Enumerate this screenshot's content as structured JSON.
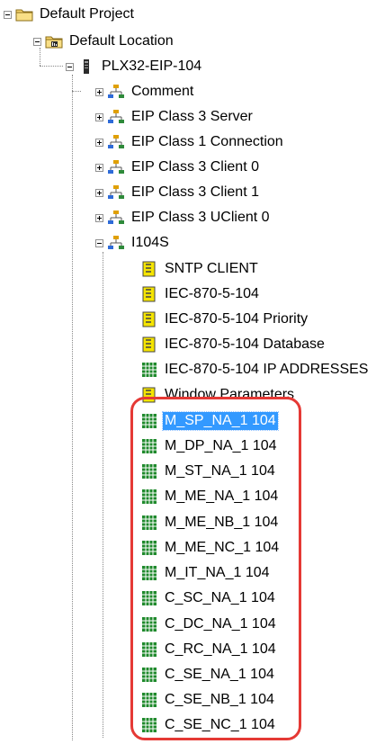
{
  "tree": {
    "root": {
      "label": "Default Project",
      "expanded": true,
      "icon": "folder-icon"
    },
    "location": {
      "label": "Default Location",
      "expanded": true,
      "icon": "location-folder-icon"
    },
    "module": {
      "label": "PLX32-EIP-104",
      "expanded": true,
      "icon": "device-icon"
    },
    "nodes": [
      {
        "label": "Comment",
        "expanded": false,
        "icon": "network-icon"
      },
      {
        "label": "EIP Class 3 Server",
        "expanded": false,
        "icon": "network-icon"
      },
      {
        "label": "EIP Class 1 Connection",
        "expanded": false,
        "icon": "network-icon"
      },
      {
        "label": "EIP Class 3 Client 0",
        "expanded": false,
        "icon": "network-icon"
      },
      {
        "label": "EIP Class 3 Client 1",
        "expanded": false,
        "icon": "network-icon"
      },
      {
        "label": "EIP Class 3 UClient 0",
        "expanded": false,
        "icon": "network-icon"
      },
      {
        "label": "I104S",
        "expanded": true,
        "icon": "network-icon"
      }
    ],
    "i104s_children": [
      {
        "label": "SNTP CLIENT",
        "icon": "config-doc-icon"
      },
      {
        "label": "IEC-870-5-104",
        "icon": "config-doc-icon"
      },
      {
        "label": "IEC-870-5-104 Priority",
        "icon": "config-doc-icon"
      },
      {
        "label": "IEC-870-5-104 Database",
        "icon": "config-doc-icon"
      },
      {
        "label": "IEC-870-5-104 IP ADDRESSES",
        "icon": "grid-table-icon"
      },
      {
        "label": "Window Parameters",
        "icon": "config-doc-icon"
      },
      {
        "label": "M_SP_NA_1 104",
        "icon": "grid-table-icon",
        "selected": true
      },
      {
        "label": "M_DP_NA_1 104",
        "icon": "grid-table-icon"
      },
      {
        "label": "M_ST_NA_1 104",
        "icon": "grid-table-icon"
      },
      {
        "label": "M_ME_NA_1 104",
        "icon": "grid-table-icon"
      },
      {
        "label": "M_ME_NB_1 104",
        "icon": "grid-table-icon"
      },
      {
        "label": "M_ME_NC_1 104",
        "icon": "grid-table-icon"
      },
      {
        "label": "M_IT_NA_1 104",
        "icon": "grid-table-icon"
      },
      {
        "label": "C_SC_NA_1 104",
        "icon": "grid-table-icon"
      },
      {
        "label": "C_DC_NA_1 104",
        "icon": "grid-table-icon"
      },
      {
        "label": "C_RC_NA_1 104",
        "icon": "grid-table-icon"
      },
      {
        "label": "C_SE_NA_1 104",
        "icon": "grid-table-icon"
      },
      {
        "label": "C_SE_NB_1 104",
        "icon": "grid-table-icon"
      },
      {
        "label": "C_SE_NC_1 104",
        "icon": "grid-table-icon"
      }
    ]
  },
  "highlight": {
    "color": "#e53935"
  },
  "colors": {
    "selection": "#3399ff",
    "folder": "#f6d36b",
    "grid_green": "#1f8a2c",
    "doc_yellow": "#f5e400"
  }
}
